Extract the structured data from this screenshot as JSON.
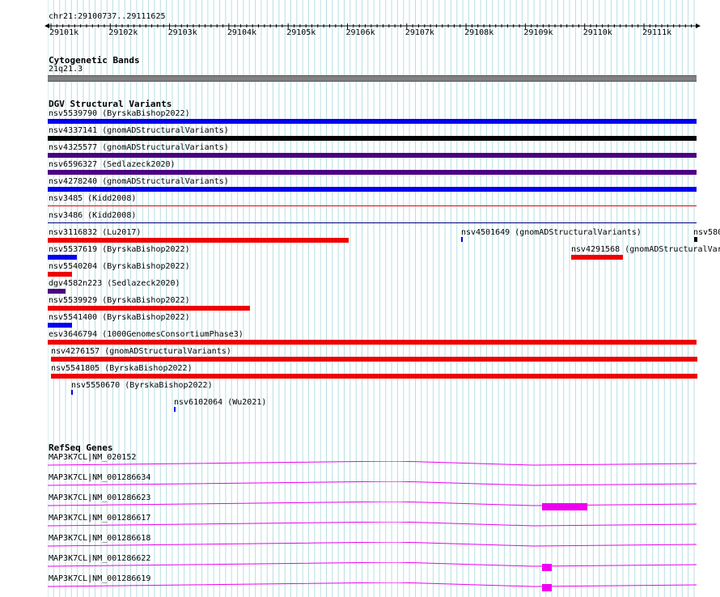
{
  "location": "chr21:29100737..29111625",
  "ruler": {
    "labels": [
      "29101k",
      "29102k",
      "29103k",
      "29104k",
      "29105k",
      "29106k",
      "29107k",
      "29108k",
      "29109k",
      "29110k",
      "29111k"
    ]
  },
  "cyto": {
    "title": "Cytogenetic Bands",
    "band": "21q21.3",
    "color": "#808080"
  },
  "dgv": {
    "title": "DGV Structural Variants",
    "items": [
      {
        "label": "nsv5539790 (ByrskaBishop2022)",
        "color": "#0000ee"
      },
      {
        "label": "nsv4337141 (gnomADStructuralVariants)",
        "color": "#000000"
      },
      {
        "label": "nsv4325577 (gnomADStructuralVariants)",
        "color": "#4b0082"
      },
      {
        "label": "nsv6596327 (Sedlazeck2020)",
        "color": "#4b0082"
      },
      {
        "label": "nsv4278240 (gnomADStructuralVariants)",
        "color": "#0000ee"
      },
      {
        "label": "nsv3485 (Kidd2008)",
        "color": "#ee0000"
      },
      {
        "label": "nsv3486 (Kidd2008)",
        "color": "#000080"
      },
      {
        "label": "nsv3116832 (Lu2017)",
        "color": "#ee0000"
      },
      {
        "label": "nsv4501649 (gnomADStructuralVariants)",
        "color": "#0000ee"
      },
      {
        "label": "nsv580",
        "color": "#000000"
      },
      {
        "label": "nsv5537619 (ByrskaBishop2022)",
        "color": "#0000ee"
      },
      {
        "label": "nsv4291568 (gnomADStructuralVar",
        "color": "#ee0000"
      },
      {
        "label": "nsv5540204 (ByrskaBishop2022)",
        "color": "#ee0000"
      },
      {
        "label": "dgv4582n223 (Sedlazeck2020)",
        "color": "#4b0082"
      },
      {
        "label": "nsv5539929 (ByrskaBishop2022)",
        "color": "#ee0000"
      },
      {
        "label": "nsv5541400 (ByrskaBishop2022)",
        "color": "#0000ee"
      },
      {
        "label": "esv3646794 (1000GenomesConsortiumPhase3)",
        "color": "#ee0000"
      },
      {
        "label": "nsv4276157 (gnomADStructuralVariants)",
        "color": "#ee0000"
      },
      {
        "label": "nsv5541805 (ByrskaBishop2022)",
        "color": "#ee0000"
      },
      {
        "label": "nsv5550670 (ByrskaBishop2022)",
        "color": "#0000ee"
      },
      {
        "label": "nsv6102064 (Wu2021)",
        "color": "#0000ee"
      }
    ]
  },
  "refseq": {
    "title": "RefSeq Genes",
    "color": "#ee00ee",
    "items": [
      {
        "label": "MAP3K7CL|NM_020152"
      },
      {
        "label": "MAP3K7CL|NM_001286634"
      },
      {
        "label": "MAP3K7CL|NM_001286623"
      },
      {
        "label": "MAP3K7CL|NM_001286617"
      },
      {
        "label": "MAP3K7CL|NM_001286618"
      },
      {
        "label": "MAP3K7CL|NM_001286622"
      },
      {
        "label": "MAP3K7CL|NM_001286619"
      }
    ]
  }
}
